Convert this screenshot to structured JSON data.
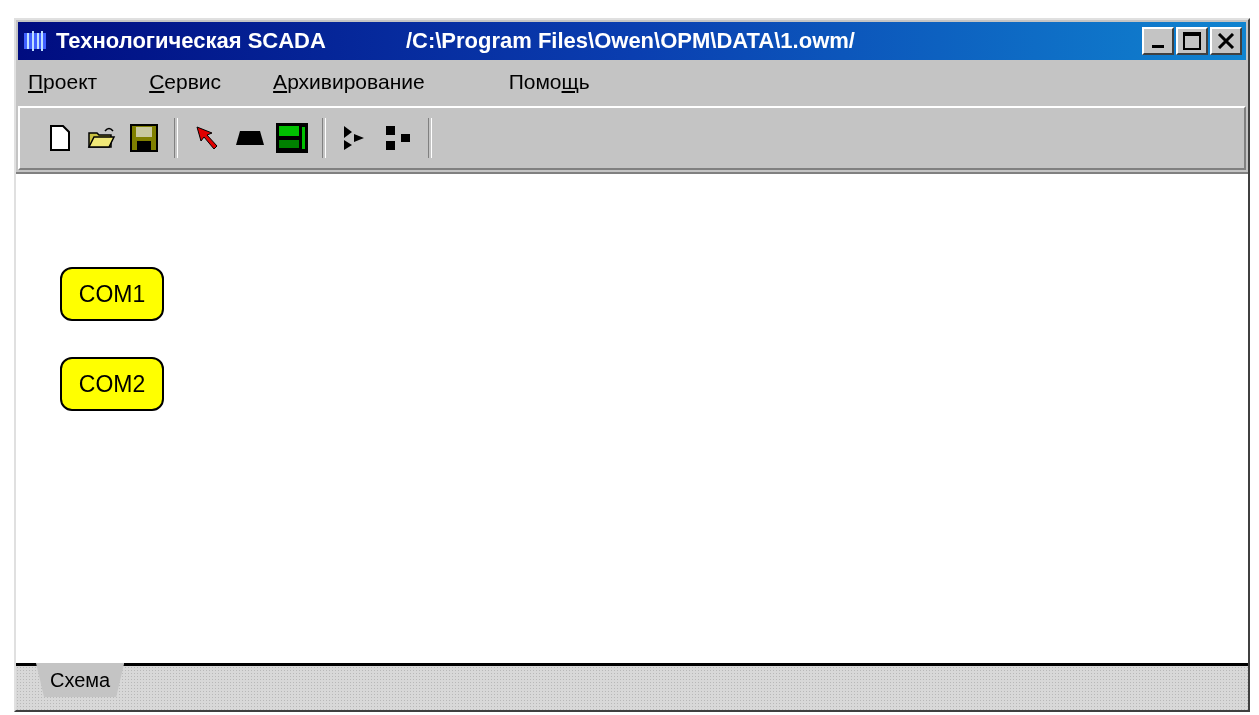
{
  "window": {
    "title": "Технологическая SCADA",
    "path": "/C:\\Program Files\\Owen\\OPM\\DATA\\1.owm/"
  },
  "menu": [
    {
      "key": "П",
      "after": "роект"
    },
    {
      "key": "С",
      "after": "ервис"
    },
    {
      "key": "А",
      "after": "рхивирование"
    },
    {
      "before": "Помо",
      "key": "щ",
      "after": "ь"
    }
  ],
  "toolbar": [
    {
      "kind": "new"
    },
    {
      "kind": "open"
    },
    {
      "kind": "save"
    },
    {
      "kind": "separator"
    },
    {
      "kind": "pointer"
    },
    {
      "kind": "block"
    },
    {
      "kind": "display"
    },
    {
      "kind": "separator"
    },
    {
      "kind": "split"
    },
    {
      "kind": "nodes"
    },
    {
      "kind": "separator"
    }
  ],
  "canvas": {
    "nodes": [
      {
        "label": "COM1"
      },
      {
        "label": "COM2"
      }
    ]
  },
  "sheet_tabs": [
    {
      "label": "Схема",
      "selected": true
    }
  ]
}
